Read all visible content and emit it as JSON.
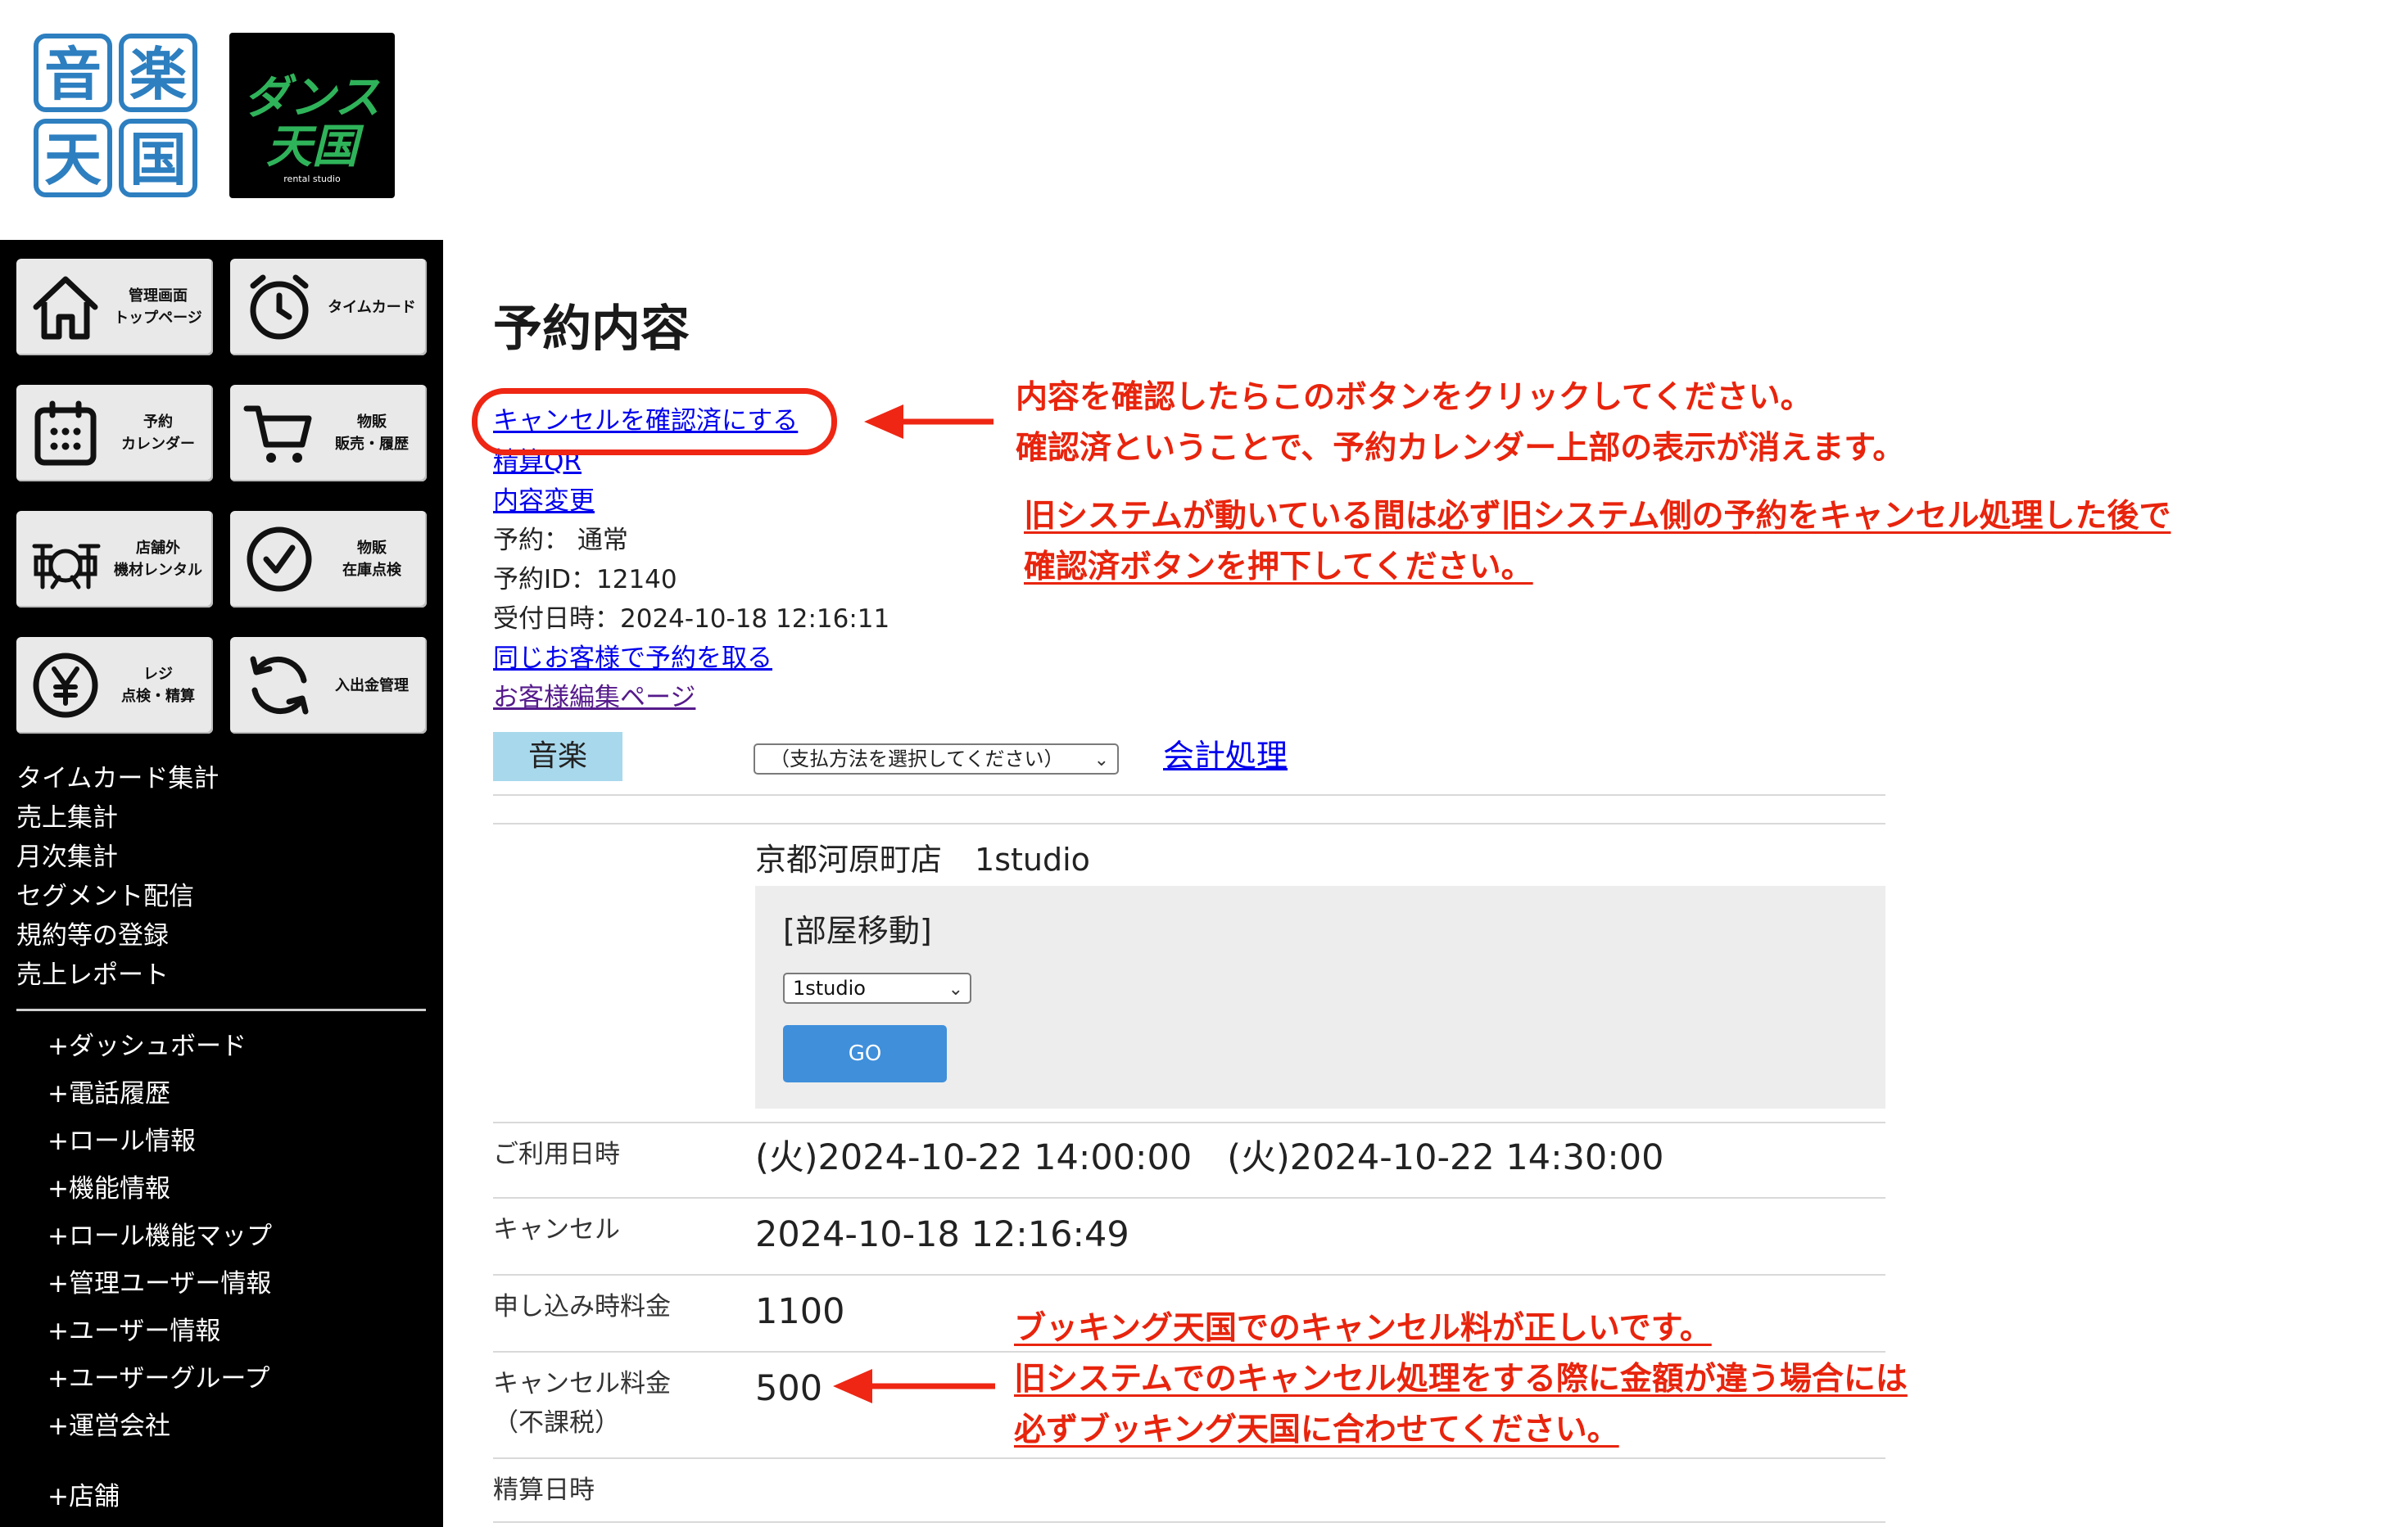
{
  "header": {
    "logo_left": {
      "chars": [
        "音",
        "楽",
        "天",
        "国"
      ],
      "color": "#2d7fc0"
    },
    "logo_right": {
      "line1": "ダンス",
      "line2": "天国",
      "tagline": "rental studio",
      "color": "#2fb35a"
    }
  },
  "sidebar": {
    "tiles": [
      {
        "icon": "home-icon",
        "label": "管理画面\nトップページ"
      },
      {
        "icon": "clock-icon",
        "label": "タイムカード"
      },
      {
        "icon": "calendar-icon",
        "label": "予約\nカレンダー"
      },
      {
        "icon": "cart-icon",
        "label": "物販\n販売・履歴"
      },
      {
        "icon": "drums-icon",
        "label": "店舗外\n機材レンタル"
      },
      {
        "icon": "check-circle-icon",
        "label": "物販\n在庫点検"
      },
      {
        "icon": "yen-icon",
        "label": "レジ\n点検・精算"
      },
      {
        "icon": "refresh-icon",
        "label": "入出金管理"
      }
    ],
    "links": [
      "タイムカード集計",
      "売上集計",
      "月次集計",
      "セグメント配信",
      "規約等の登録",
      "売上レポート"
    ],
    "sub_links": [
      "+ダッシュボード",
      "+電話履歴",
      "+ロール情報",
      "+機能情報",
      "+ロール機能マップ",
      "+管理ユーザー情報",
      "+ユーザー情報",
      "+ユーザーグループ",
      "+運営会社",
      "+店舗"
    ]
  },
  "main": {
    "title": "予約内容",
    "cancel_confirm_link": "キャンセルを確認済にする",
    "settlement_qr_link": "精算QR",
    "edit_content_link": "内容変更",
    "reservation_type": "予約： 通常",
    "reservation_id": "予約ID：12140",
    "received_at": "受付日時：2024-10-18 12:16:11",
    "same_customer_link": "同じお客様で予約を取る",
    "customer_edit_link": "お客様編集ページ",
    "category_badge": "音楽",
    "payment_select": "（支払方法を選択してください）",
    "accounting_link": "会計処理",
    "store": "京都河原町店",
    "studio": "1studio",
    "room_move": {
      "title": "[部屋移動]",
      "selected_room": "1studio",
      "go_label": "GO"
    },
    "rows": [
      {
        "label": "ご利用日時",
        "value": "(火)2024-10-22 14:00:00　(火)2024-10-22 14:30:00"
      },
      {
        "label": "キャンセル",
        "value": "2024-10-18 12:16:49"
      },
      {
        "label": "申し込み時料金",
        "value": "1100"
      },
      {
        "label": "キャンセル料金",
        "label2": "（不課税）",
        "value": "500"
      },
      {
        "label": "精算日時",
        "value": ""
      }
    ]
  },
  "annotations": {
    "note1": [
      "内容を確認したらこのボタンをクリックしてください。",
      "確認済ということで、予約カレンダー上部の表示が消えます。"
    ],
    "note2": [
      "旧システムが動いている間は必ず旧システム側の予約をキャンセル処理した後で",
      "確認済ボタンを押下してください。"
    ],
    "note3": [
      "ブッキング天国でのキャンセル料が正しいです。",
      "旧システムでのキャンセル処理をする際に金額が違う場合には",
      "必ずブッキング天国に合わせてください。"
    ],
    "color": "#e8240d"
  }
}
